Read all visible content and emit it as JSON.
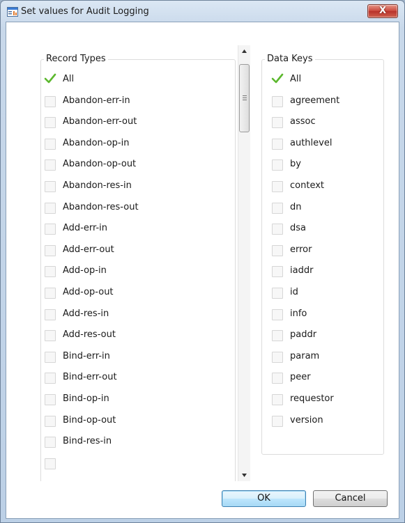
{
  "window": {
    "title": "Set values for Audit Logging",
    "close_label": "X"
  },
  "record_types": {
    "title": "Record Types",
    "items": [
      {
        "label": "All",
        "checked": true
      },
      {
        "label": "Abandon-err-in",
        "checked": false
      },
      {
        "label": "Abandon-err-out",
        "checked": false
      },
      {
        "label": "Abandon-op-in",
        "checked": false
      },
      {
        "label": "Abandon-op-out",
        "checked": false
      },
      {
        "label": "Abandon-res-in",
        "checked": false
      },
      {
        "label": "Abandon-res-out",
        "checked": false
      },
      {
        "label": "Add-err-in",
        "checked": false
      },
      {
        "label": "Add-err-out",
        "checked": false
      },
      {
        "label": "Add-op-in",
        "checked": false
      },
      {
        "label": "Add-op-out",
        "checked": false
      },
      {
        "label": "Add-res-in",
        "checked": false
      },
      {
        "label": "Add-res-out",
        "checked": false
      },
      {
        "label": "Bind-err-in",
        "checked": false
      },
      {
        "label": "Bind-err-out",
        "checked": false
      },
      {
        "label": "Bind-op-in",
        "checked": false
      },
      {
        "label": "Bind-op-out",
        "checked": false
      },
      {
        "label": "Bind-res-in",
        "checked": false
      },
      {
        "label": "",
        "checked": false
      }
    ]
  },
  "data_keys": {
    "title": "Data Keys",
    "items": [
      {
        "label": "All",
        "checked": true
      },
      {
        "label": "agreement",
        "checked": false
      },
      {
        "label": "assoc",
        "checked": false
      },
      {
        "label": "authlevel",
        "checked": false
      },
      {
        "label": "by",
        "checked": false
      },
      {
        "label": "context",
        "checked": false
      },
      {
        "label": "dn",
        "checked": false
      },
      {
        "label": "dsa",
        "checked": false
      },
      {
        "label": "error",
        "checked": false
      },
      {
        "label": "iaddr",
        "checked": false
      },
      {
        "label": "id",
        "checked": false
      },
      {
        "label": "info",
        "checked": false
      },
      {
        "label": "paddr",
        "checked": false
      },
      {
        "label": "param",
        "checked": false
      },
      {
        "label": "peer",
        "checked": false
      },
      {
        "label": "requestor",
        "checked": false
      },
      {
        "label": "version",
        "checked": false
      }
    ]
  },
  "buttons": {
    "ok": "OK",
    "cancel": "Cancel"
  },
  "colors": {
    "check": "#5cb82e",
    "title_bar": "#c8d8ea",
    "close": "#c9463a",
    "default_button_border": "#3c7fb1"
  }
}
